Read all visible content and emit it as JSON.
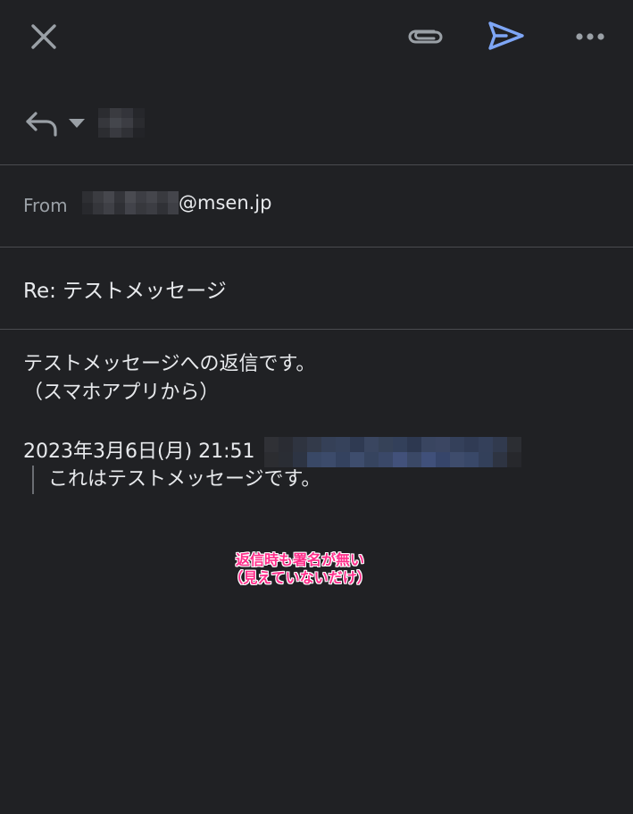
{
  "toolbar": {
    "close_icon": "close-icon",
    "attach_icon": "paperclip-icon",
    "send_icon": "send-icon",
    "more_icon": "more-horizontal-icon",
    "send_color": "#7ea6f6"
  },
  "reply": {
    "icon": "reply-icon",
    "caret": "caret-down-icon"
  },
  "from": {
    "label": "From",
    "email_domain": "@msen.jp"
  },
  "subject": "Re: テストメッセージ",
  "body": {
    "lines": [
      "テストメッセージへの返信です。",
      "（スマホアプリから）"
    ],
    "quote_header": "2023年3月6日(月) 21:51",
    "quote_text": "これはテストメッセージです。"
  },
  "annotation": {
    "line1": "返信時も署名が無い",
    "line2": "（見えていないだけ）",
    "color": "#ff2d8a"
  }
}
